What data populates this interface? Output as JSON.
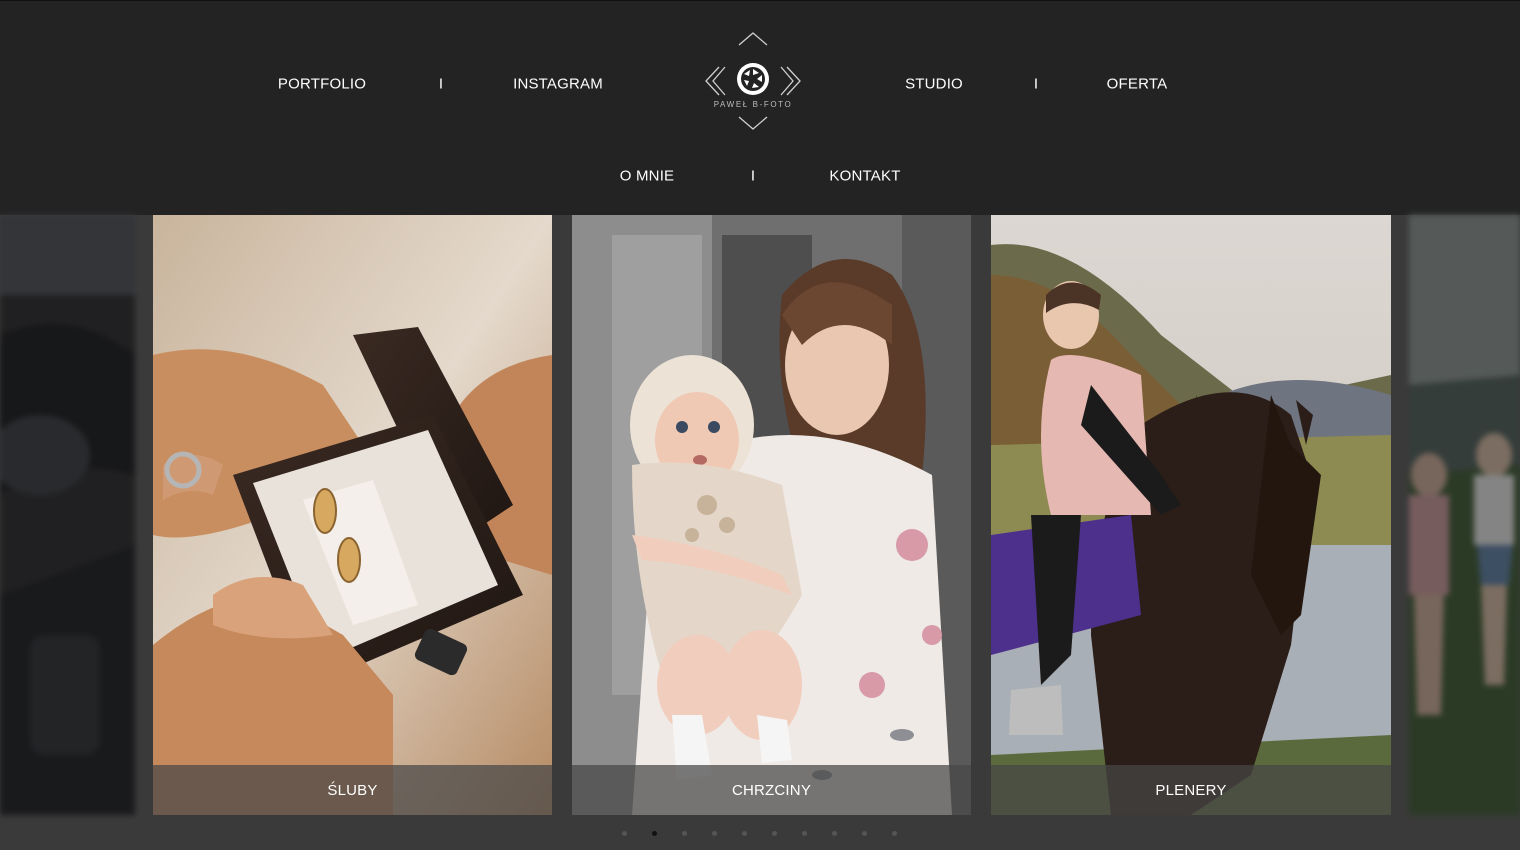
{
  "nav": {
    "portfolio": "PORTFOLIO",
    "instagram": "INSTAGRAM",
    "studio": "STUDIO",
    "oferta": "OFERTA",
    "o_mnie": "O MNIE",
    "kontakt": "KONTAKT",
    "separator": "I"
  },
  "logo": {
    "text": "PAWEŁ B-FOTO",
    "icon": "camera-aperture-icon"
  },
  "slides": [
    {
      "caption": "ŚLUBY",
      "image": "wedding-rings-photo"
    },
    {
      "caption": "CHRZCINY",
      "image": "mother-with-baby-photo"
    },
    {
      "caption": "PLENERY",
      "image": "girl-on-horse-photo"
    }
  ],
  "carousel": {
    "dot_count": 10,
    "active_index": 1
  },
  "colors": {
    "header_bg": "#232323",
    "slider_bg": "#3a3a3a",
    "caption_bg": "rgba(70,70,70,0.72)",
    "text": "#ffffff"
  }
}
